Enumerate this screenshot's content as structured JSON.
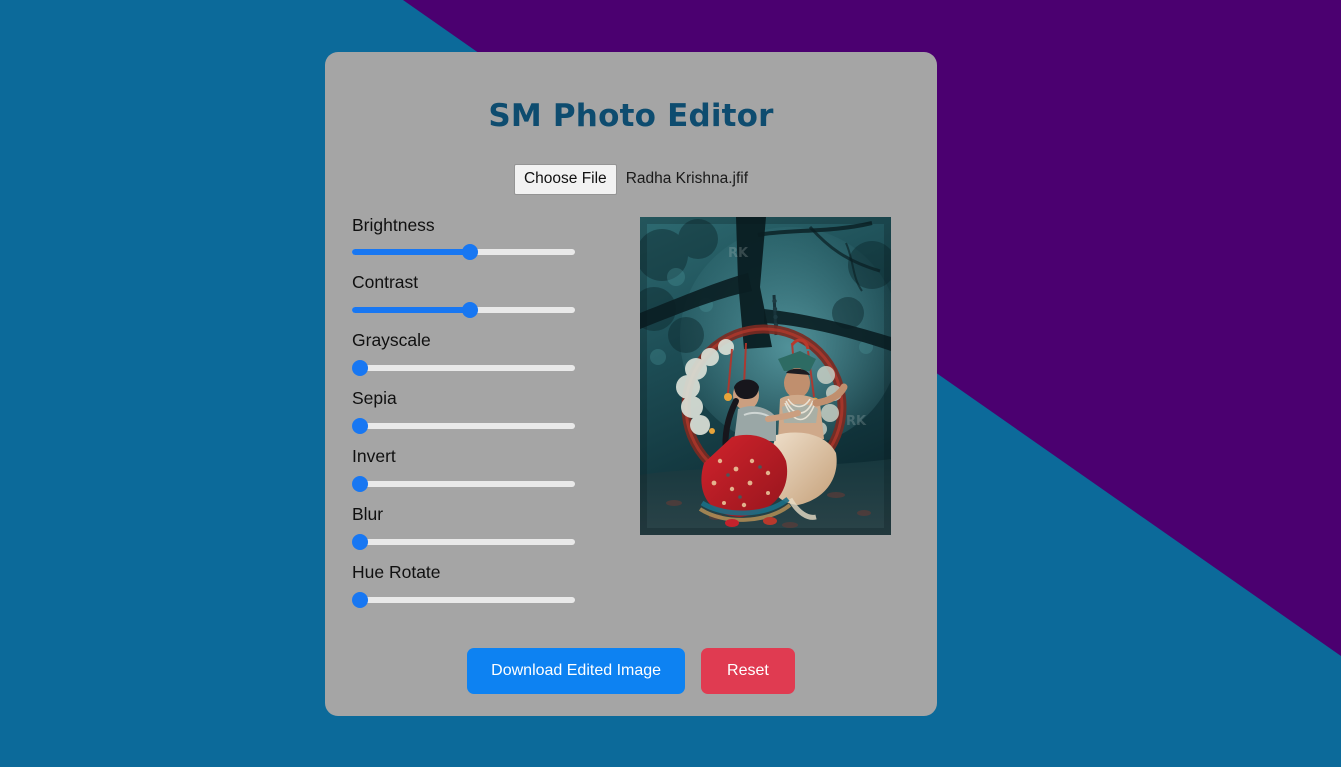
{
  "background": {
    "base_color": "#0c6a9a",
    "wedge_color": "#4b0070",
    "wedge_label": "diagonal-purple-wedge"
  },
  "card": {
    "background_color": "#a5a5a5"
  },
  "header": {
    "title": "SM Photo Editor",
    "title_color": "#0e4c6f"
  },
  "file_input": {
    "button_label": "Choose File",
    "file_name": "Radha Krishna.jfif"
  },
  "controls": {
    "accent_color": "#1877f2",
    "track_color": "#e9e9e9",
    "sliders": [
      {
        "label": "Brightness",
        "value": 53,
        "min": 0,
        "max": 100
      },
      {
        "label": "Contrast",
        "value": 53,
        "min": 0,
        "max": 100
      },
      {
        "label": "Grayscale",
        "value": 0,
        "min": 0,
        "max": 100
      },
      {
        "label": "Sepia",
        "value": 0,
        "min": 0,
        "max": 100
      },
      {
        "label": "Invert",
        "value": 0,
        "min": 0,
        "max": 100
      },
      {
        "label": "Blur",
        "value": 0,
        "min": 0,
        "max": 100
      },
      {
        "label": "Hue Rotate",
        "value": 0,
        "min": 0,
        "max": 100
      }
    ]
  },
  "preview": {
    "alt": "Radha Krishna seated together on a decorated floral swing hanging from a tree, teal forest background",
    "dominant_colors": [
      "#1d4c52",
      "#0b2a30",
      "#c4202a",
      "#d9c2a6"
    ]
  },
  "actions": {
    "download_label": "Download Edited Image",
    "download_color": "#0d82f2",
    "reset_label": "Reset",
    "reset_color": "#e03b51"
  }
}
